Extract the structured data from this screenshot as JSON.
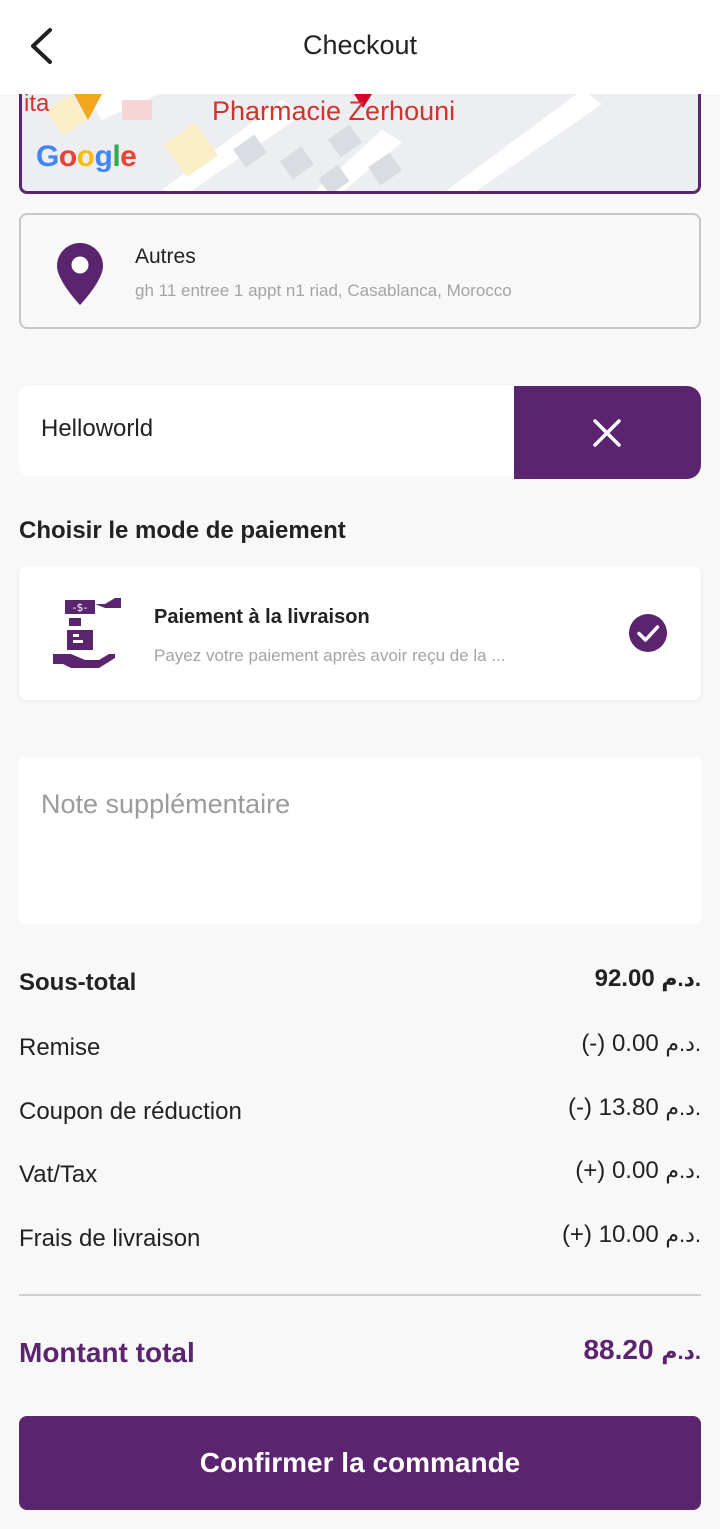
{
  "header": {
    "title": "Checkout",
    "back_icon": "chevron-left-icon"
  },
  "map": {
    "place_label": "Pharmacie Zerhouni",
    "partial_label": "ita",
    "google_logo": "Google"
  },
  "address": {
    "type": "Autres",
    "line": "gh 11 entree 1 appt n1 riad, Casablanca, Morocco",
    "icon": "location-pin-icon"
  },
  "coupon": {
    "value": "Helloworld",
    "clear_icon": "close-icon"
  },
  "payment": {
    "section_title": "Choisir le mode de paiement",
    "method_title": "Paiement à la livraison",
    "method_desc": "Payez votre paiement après avoir reçu de la ...",
    "icon": "cash-on-delivery-icon",
    "selected_icon": "check-circle-icon"
  },
  "note": {
    "placeholder": "Note supplémentaire"
  },
  "summary": {
    "currency": "د.م.",
    "rows": [
      {
        "label": "Sous-total",
        "value": "92.00"
      },
      {
        "label": "Remise",
        "value": "(-) 0.00"
      },
      {
        "label": "Coupon de réduction",
        "value": "(-) 13.80"
      },
      {
        "label": "Vat/Tax",
        "value": "(+) 0.00"
      },
      {
        "label": "Frais de livraison",
        "value": "(+) 10.00"
      }
    ],
    "total_label": "Montant total",
    "total_value": "88.20"
  },
  "confirm_button": "Confirmer la commande",
  "colors": {
    "brand": "#5b246e",
    "background": "#f8f8f8",
    "muted_text": "#a4a4a4"
  }
}
